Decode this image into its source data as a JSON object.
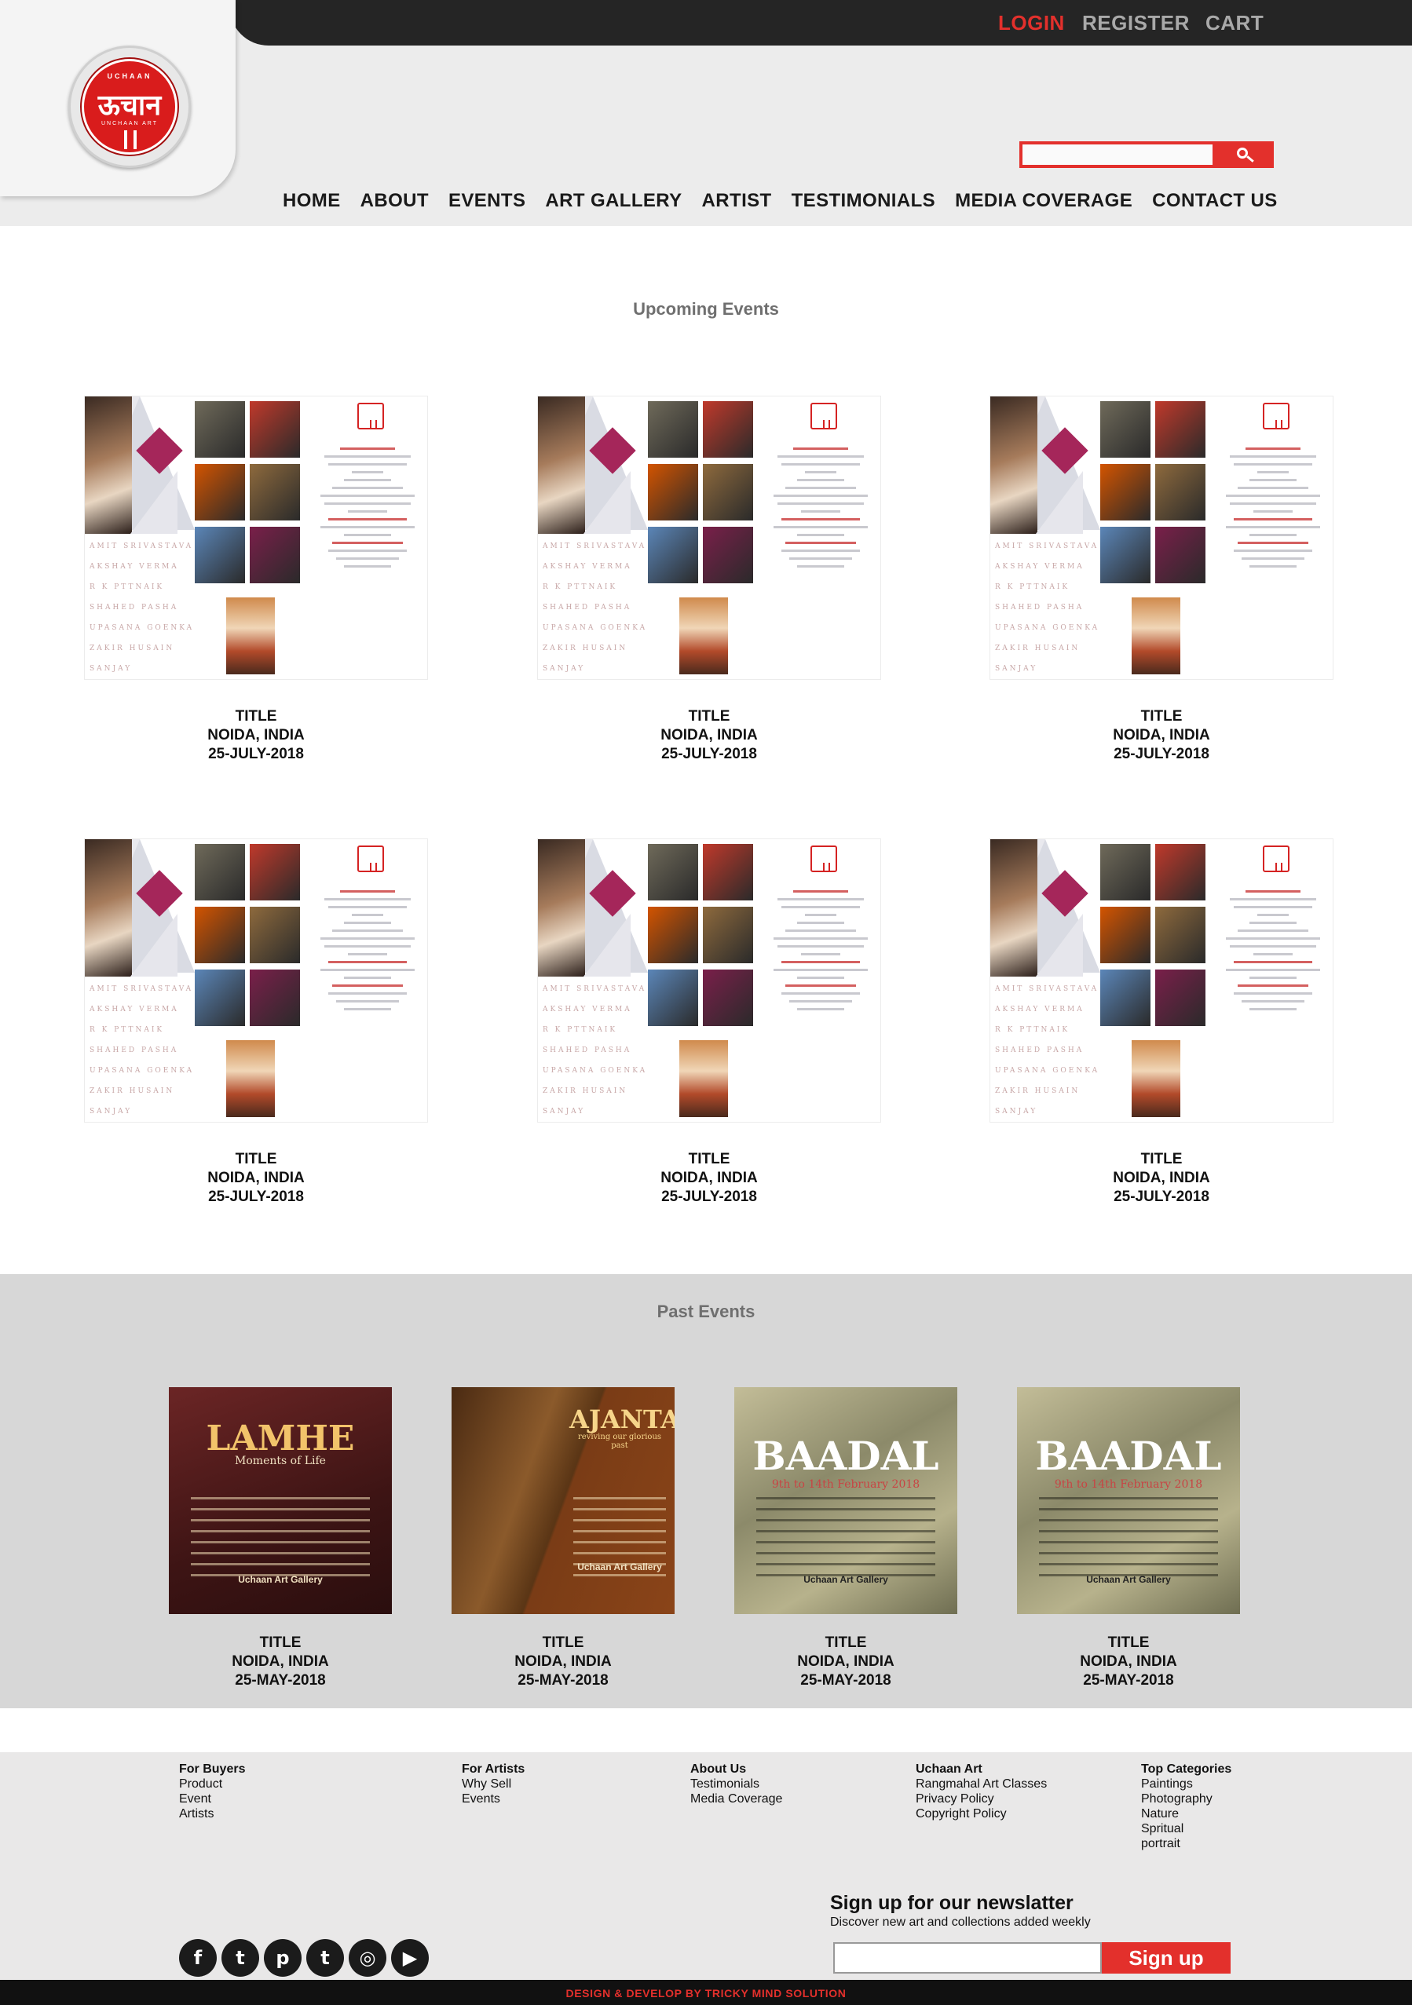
{
  "header": {
    "logo": {
      "small": "UCHAAN",
      "main": "ऊचान",
      "sub": "UNCHAAN ART"
    },
    "auth": {
      "login": "LOGIN",
      "register": "REGISTER",
      "cart": "CART"
    },
    "search": {
      "value": "",
      "icon": "search-icon"
    },
    "nav": [
      "HOME",
      "ABOUT",
      "EVENTS",
      "ART GALLERY",
      "ARTIST",
      "TESTIMONIALS",
      "MEDIA COVERAGE",
      "CONTACT US"
    ],
    "colors": {
      "accent": "#e3302c",
      "topbar": "#252525"
    }
  },
  "upcoming": {
    "title": "Upcoming Events",
    "poster_names": [
      "AMIT SRIVASTAVA",
      "AKSHAY VERMA",
      "R K PTTNAIK",
      "SHAHED PASHA",
      "UPASANA GOENKA",
      "ZAKIR HUSAIN",
      "SANJAY CHAKRABORTY"
    ],
    "events": [
      {
        "title": "TITLE",
        "location": "NOIDA, INDIA",
        "date": "25-JULY-2018"
      },
      {
        "title": "TITLE",
        "location": "NOIDA, INDIA",
        "date": "25-JULY-2018"
      },
      {
        "title": "TITLE",
        "location": "NOIDA, INDIA",
        "date": "25-JULY-2018"
      },
      {
        "title": "TITLE",
        "location": "NOIDA, INDIA",
        "date": "25-JULY-2018"
      },
      {
        "title": "TITLE",
        "location": "NOIDA, INDIA",
        "date": "25-JULY-2018"
      },
      {
        "title": "TITLE",
        "location": "NOIDA, INDIA",
        "date": "25-JULY-2018"
      }
    ]
  },
  "past": {
    "title": "Past Events",
    "events": [
      {
        "poster_heading": "LAMHE",
        "poster_sub": "Moments of Life",
        "poster_venue": "Uchaan Art Gallery",
        "title": "TITLE",
        "location": "NOIDA, INDIA",
        "date": "25-MAY-2018"
      },
      {
        "poster_heading": "AJANTA",
        "poster_sub": "reviving our glorious past",
        "poster_venue": "Uchaan Art Gallery",
        "title": "TITLE",
        "location": "NOIDA, INDIA",
        "date": "25-MAY-2018"
      },
      {
        "poster_heading": "BAADAL",
        "poster_sub": "9th to 14th February 2018",
        "poster_venue": "Uchaan Art Gallery",
        "title": "TITLE",
        "location": "NOIDA, INDIA",
        "date": "25-MAY-2018"
      },
      {
        "poster_heading": "BAADAL",
        "poster_sub": "9th to 14th February 2018",
        "poster_venue": "Uchaan Art Gallery",
        "title": "TITLE",
        "location": "NOIDA, INDIA",
        "date": "25-MAY-2018"
      }
    ]
  },
  "footer": {
    "columns": [
      {
        "head": "For Buyers",
        "links": [
          "Product",
          "Event",
          "Artists"
        ]
      },
      {
        "head": "For Artists",
        "links": [
          "Why Sell",
          "Events"
        ]
      },
      {
        "head": "About Us",
        "links": [
          "Testimonials",
          "Media Coverage"
        ]
      },
      {
        "head": "Uchaan Art",
        "links": [
          "Rangmahal Art Classes",
          "Privacy Policy",
          "Copyright Policy"
        ]
      },
      {
        "head": "Top Categories",
        "links": [
          "Paintings",
          "Photography",
          "Nature",
          "Spritual",
          "portrait"
        ]
      }
    ],
    "newsletter": {
      "title": "Sign up for our newslatter",
      "subtitle": "Discover new art and collections added weekly",
      "button": "Sign up",
      "value": ""
    },
    "social": [
      {
        "icon": "facebook-icon",
        "glyph": "f"
      },
      {
        "icon": "twitter-icon",
        "glyph": "t"
      },
      {
        "icon": "pinterest-icon",
        "glyph": "p"
      },
      {
        "icon": "tumblr-icon",
        "glyph": "t"
      },
      {
        "icon": "instagram-icon",
        "glyph": "◎"
      },
      {
        "icon": "youtube-icon",
        "glyph": "▶"
      }
    ],
    "credit": "DESIGN & DEVELOP BY TRICKY MIND SOLUTION"
  }
}
